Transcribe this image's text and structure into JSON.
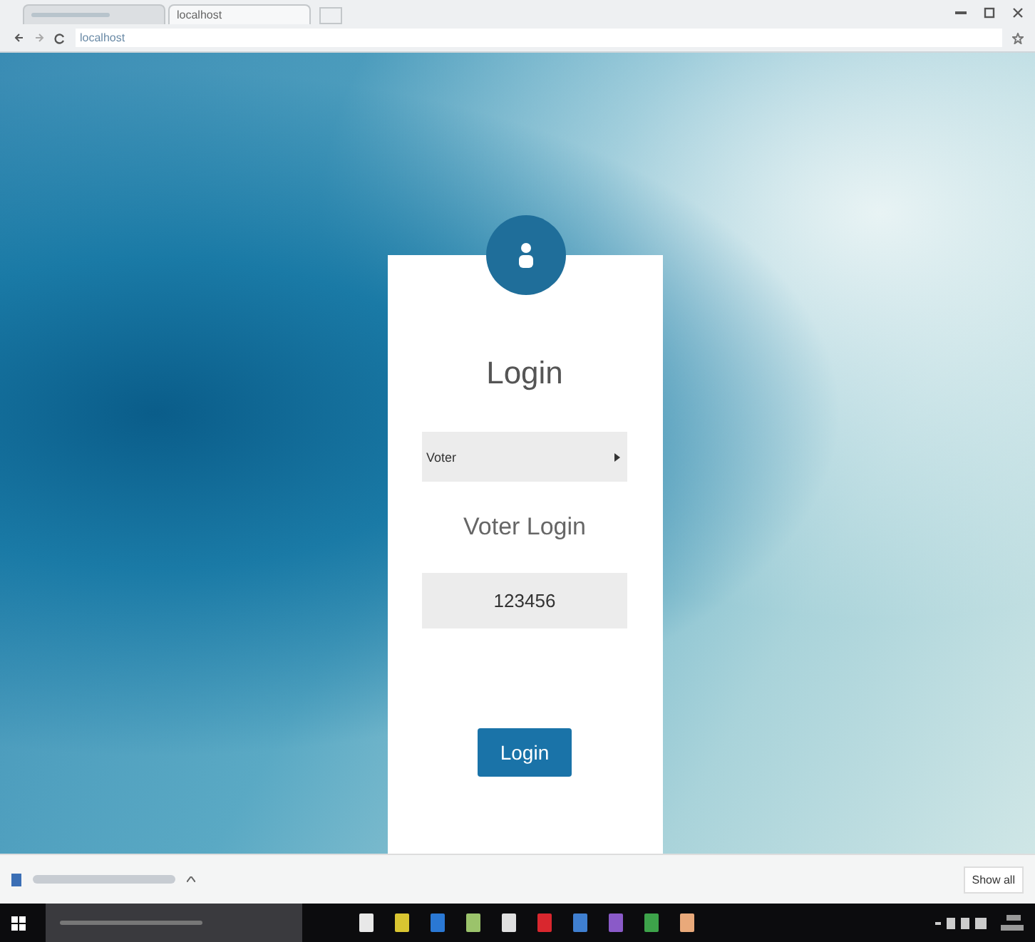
{
  "browser": {
    "tabs": [
      {
        "selected": false
      },
      {
        "title": "localhost",
        "selected": true
      }
    ],
    "address": "localhost"
  },
  "login": {
    "title": "Login",
    "role_select": {
      "value": "Voter"
    },
    "subtitle": "Voter Login",
    "id_field": {
      "value": "123456"
    },
    "button": "Login"
  },
  "download_bar": {
    "show_all": "Show all"
  }
}
